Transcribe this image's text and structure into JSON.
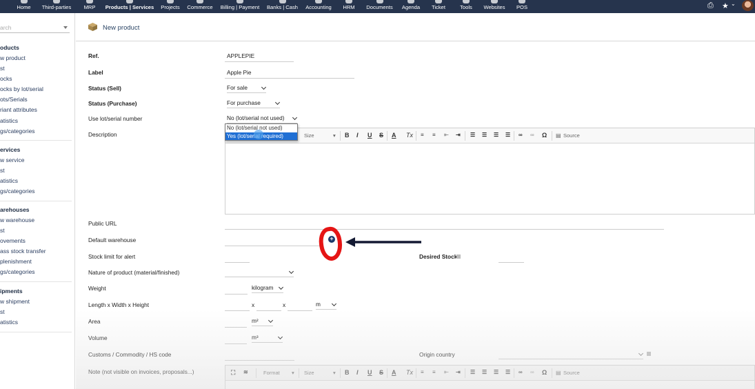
{
  "topnav": {
    "items": [
      {
        "label": "Home",
        "active": false
      },
      {
        "label": "Third-parties",
        "active": false
      },
      {
        "label": "MRP",
        "active": false
      },
      {
        "label": "Products | Services",
        "active": true
      },
      {
        "label": "Projects",
        "active": false
      },
      {
        "label": "Commerce",
        "active": false
      },
      {
        "label": "Billing | Payment",
        "active": false
      },
      {
        "label": "Banks | Cash",
        "active": false
      },
      {
        "label": "Accounting",
        "active": false
      },
      {
        "label": "HRM",
        "active": false
      },
      {
        "label": "Documents",
        "active": false
      },
      {
        "label": "Agenda",
        "active": false
      },
      {
        "label": "Ticket",
        "active": false
      },
      {
        "label": "Tools",
        "active": false
      },
      {
        "label": "Websites",
        "active": false
      },
      {
        "label": "POS",
        "active": false
      }
    ],
    "print_icon": "⎙",
    "bookmark_icon": "★",
    "bookmark_caret": "⌄"
  },
  "leftmenu": {
    "search_placeholder": "arch",
    "sections": [
      {
        "head": "oducts",
        "links": [
          "w product",
          "st",
          "ocks",
          "ocks by lot/serial",
          "ots/Serials",
          "riant attributes",
          "atistics",
          "gs/categories"
        ]
      },
      {
        "head": "ervices",
        "links": [
          "w service",
          "st",
          "atistics",
          "gs/categories"
        ]
      },
      {
        "head": "arehouses",
        "links": [
          "w warehouse",
          "st",
          "ovements",
          "ass stock transfer",
          "plenishment",
          "gs/categories"
        ]
      },
      {
        "head": "ipments",
        "links": [
          "w shipment",
          "st",
          "atistics"
        ]
      }
    ]
  },
  "page": {
    "title": "New product"
  },
  "form": {
    "ref_label": "Ref.",
    "ref_value": "APPLEPIE",
    "label_label": "Label",
    "label_value": "Apple Pie",
    "status_sell_label": "Status (Sell)",
    "status_sell_value": "For sale",
    "status_purchase_label": "Status (Purchase)",
    "status_purchase_value": "For purchase",
    "lot_label": "Use lot/serial number",
    "lot_value": "No (lot/serial not used)",
    "lot_options": [
      "No (lot/serial not used)",
      "Yes (lot/serial required)"
    ],
    "description_label": "Description",
    "public_url_label": "Public URL",
    "default_warehouse_label": "Default warehouse",
    "stock_alert_label": "Stock limit for alert",
    "desired_stock_label": "Desired Stock",
    "nature_label": "Nature of product (material/finished)",
    "weight_label": "Weight",
    "weight_unit": "kilogram",
    "dims_label": "Length x Width x Height",
    "dims_x1": "x",
    "dims_x2": "x",
    "dims_unit": "m",
    "area_label": "Area",
    "area_unit": "m²",
    "volume_label": "Volume",
    "volume_unit": "m³",
    "customs_label": "Customs / Commodity / HS code",
    "origin_label": "Origin country",
    "note_label": "Note (not visible on invoices, proposals...)"
  },
  "editor": {
    "format_label": "Format",
    "size_label": "Size",
    "source_label": "Source",
    "bold": "B",
    "italic": "I",
    "underline": "U",
    "strike": "S",
    "color": "A",
    "removeformat": "Tx",
    "special_char": "Ω",
    "maximize": "⛶"
  },
  "colors": {
    "topbar": "#26344d",
    "annotation_red": "#e51515",
    "dropdown_highlight": "#1f6fd4"
  }
}
